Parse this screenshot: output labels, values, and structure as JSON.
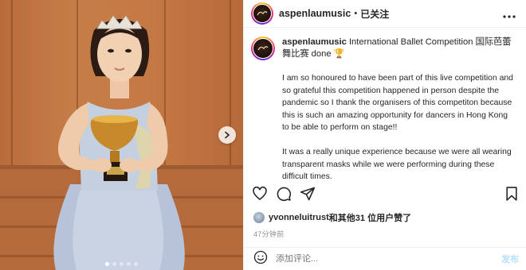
{
  "post_image": {
    "alt_icon": "trophy-photo",
    "carousel": {
      "dot_count": 5,
      "active_dot": 0,
      "next_icon": "chevron-right-icon"
    }
  },
  "header": {
    "username": "aspenlaumusic",
    "separator": "•",
    "follow_status": "已关注",
    "more_icon": "more-horizontal-icon"
  },
  "caption": {
    "username": "aspenlaumusic",
    "title": "International Ballet Competition 国际芭蕾舞比赛 done",
    "emoji": "🏆",
    "paragraphs": [
      "I am so honoured to have been part of this live competition and so grateful this competition happened in person despite the pandemic so I thank the organisers of this competiton because this is such an amazing opportunity for dancers in Hong Kong to be able to perform on stage!!",
      "It was a really unique experience because we were all wearing transparent masks while we were performing during these difficult times."
    ]
  },
  "actions": {
    "like_icon": "heart-icon",
    "comment_icon": "comment-icon",
    "share_icon": "share-icon",
    "save_icon": "bookmark-icon"
  },
  "likes": {
    "user": "yvonneluitrust",
    "rest": "和其他31 位用户赞了"
  },
  "timestamp": "47分钟前",
  "comment_box": {
    "emoji_icon": "smiley-icon",
    "placeholder": "添加评论...",
    "post_label": "发布"
  },
  "colors": {
    "post_button_disabled": "#b2dffc",
    "muted_text": "#8e8e8e",
    "border": "#efefef"
  }
}
